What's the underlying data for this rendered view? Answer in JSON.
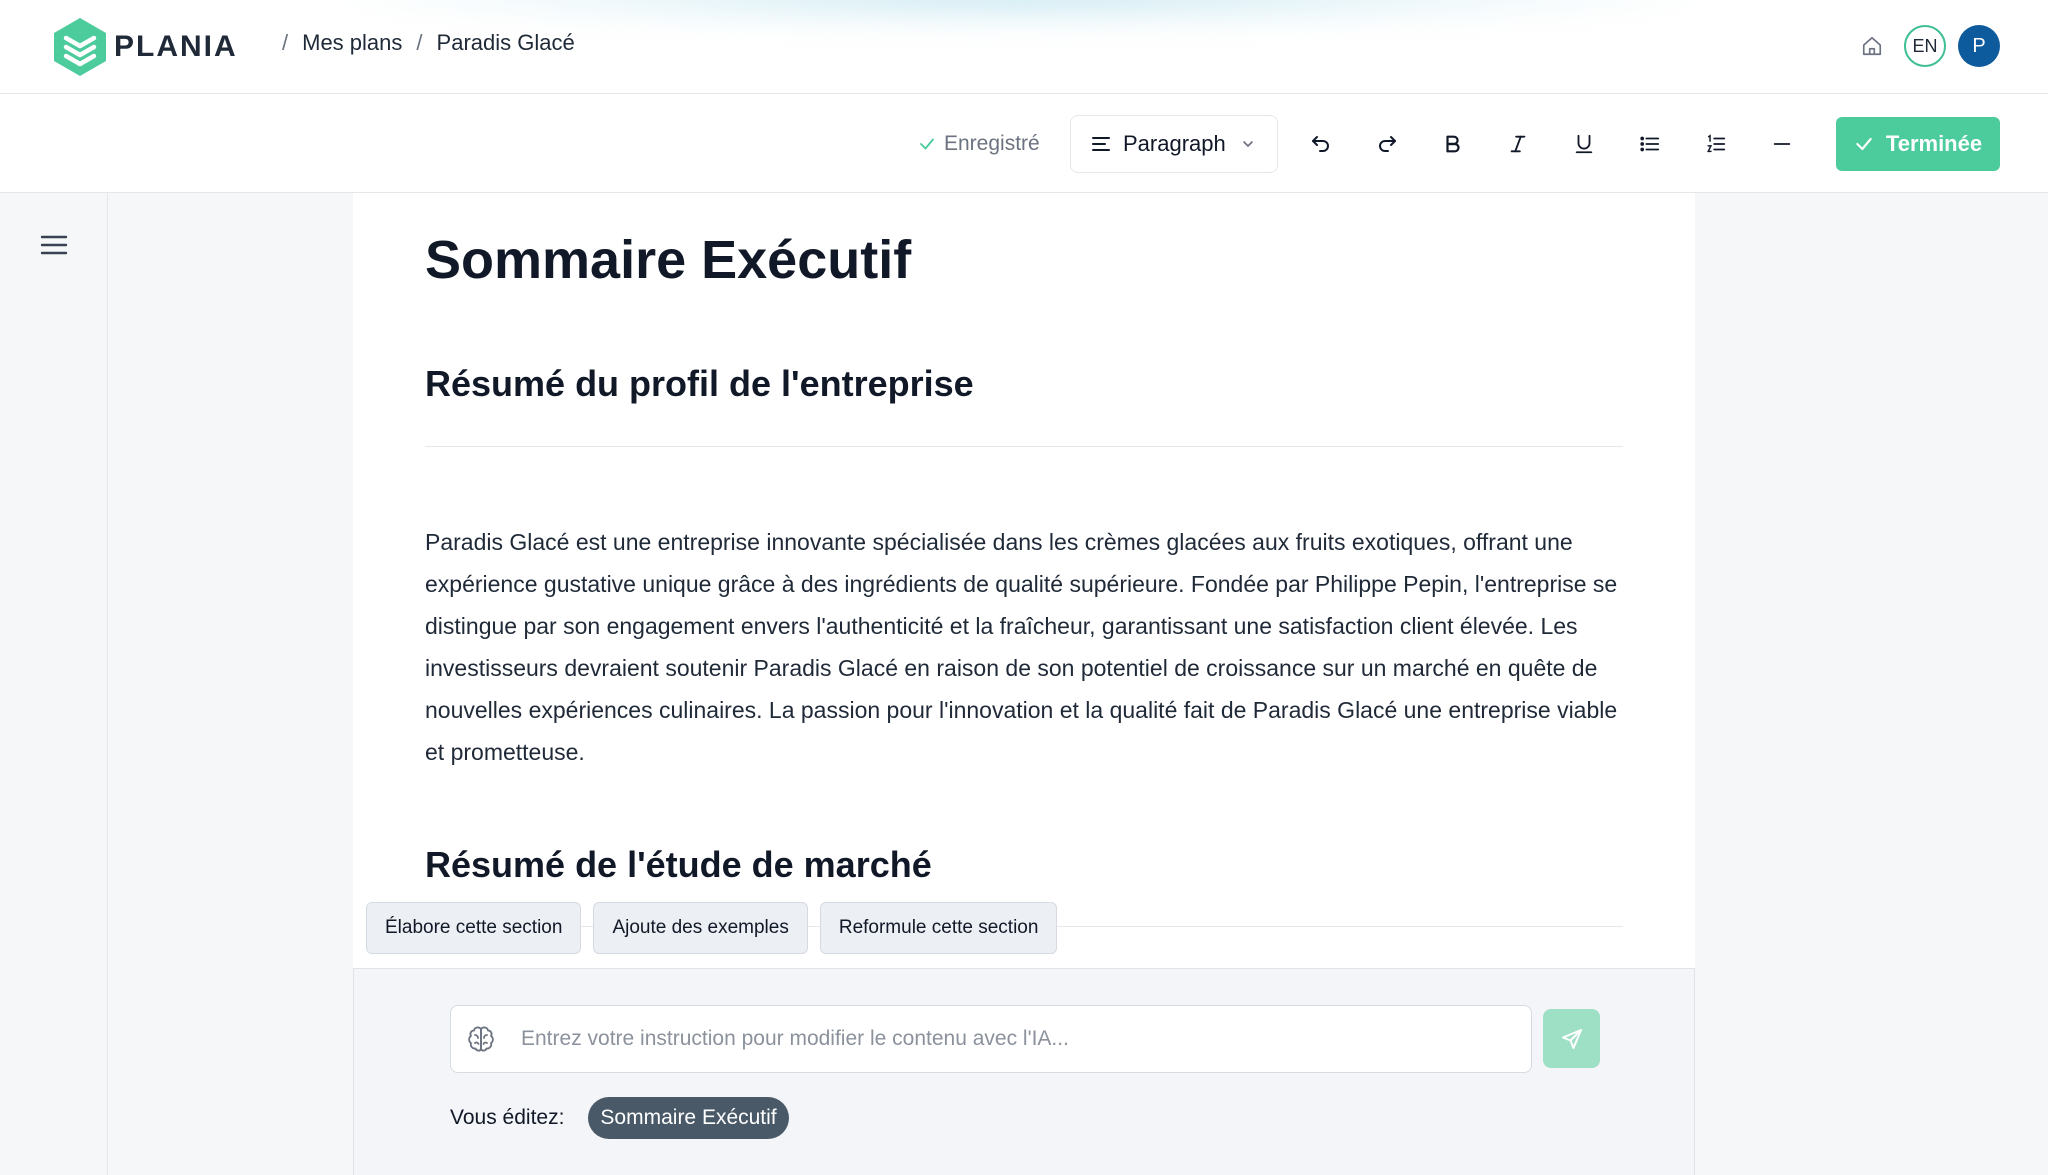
{
  "header": {
    "logo_text": "PLANIA",
    "breadcrumb": [
      "Mes plans",
      "Paradis Glacé"
    ],
    "breadcrumb_separator": "/",
    "lang": "EN",
    "avatar_initial": "P",
    "accent_color": "#4ccb9c",
    "avatar_color": "#0d5a9c"
  },
  "toolbar": {
    "saved_status": "Enregistré",
    "block_type": "Paragraph",
    "buttons": [
      "undo-icon",
      "redo-icon",
      "bold-icon",
      "italic-icon",
      "underline-icon",
      "bullet-list-icon",
      "ordered-list-icon",
      "horizontal-rule-icon"
    ],
    "done_label": "Terminée"
  },
  "document": {
    "title": "Sommaire Exécutif",
    "section1_title": "Résumé du profil de l'entreprise",
    "section1_body": "Paradis Glacé est une entreprise innovante spécialisée dans les crèmes glacées aux fruits exotiques, offrant une expérience gustative unique grâce à des ingrédients de qualité supérieure. Fondée par Philippe Pepin, l'entreprise se distingue par son engagement envers l'authenticité et la fraîcheur, garantissant une satisfaction client élevée. Les investisseurs devraient soutenir Paradis Glacé en raison de son potentiel de croissance sur un marché en quête de nouvelles expériences culinaires. La passion pour l'innovation et la qualité fait de Paradis Glacé une entreprise viable et prometteuse.",
    "section2_title": "Résumé de l'étude de marché"
  },
  "ai": {
    "chips": [
      "Élabore cette section",
      "Ajoute des exemples",
      "Reformule cette section"
    ],
    "input_placeholder": "Entrez votre instruction pour modifier le contenu avec l'IA...",
    "input_value": "",
    "editing_label": "Vous éditez:",
    "editing_section": "Sommaire Exécutif"
  }
}
